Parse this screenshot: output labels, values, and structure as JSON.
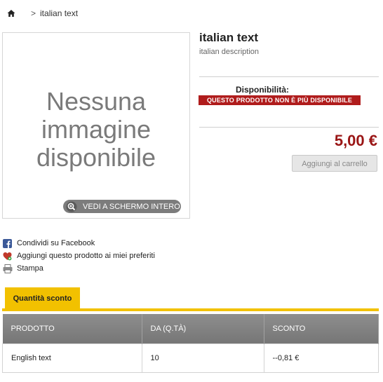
{
  "breadcrumb": {
    "home_icon": "home-icon",
    "separator": ">",
    "current": "italian text"
  },
  "image": {
    "placeholder_lines": [
      "Nessuna",
      "immagine",
      "disponibile"
    ],
    "fullscreen_label": "VEDI A SCHERMO INTERO",
    "fullscreen_icon": "zoom-icon"
  },
  "product": {
    "title": "italian text",
    "description": "italian description",
    "availability_label": "Disponibilità:",
    "availability_status": "QUESTO PRODOTTO NON È PIÙ DISPONIBILE",
    "price": "5,00 €",
    "add_to_cart_label": "Aggiungi al carrello"
  },
  "actions": [
    {
      "icon": "facebook-icon",
      "label": "Condividi su Facebook"
    },
    {
      "icon": "heart-icon",
      "label": "Aggiungi questo prodotto ai miei preferiti"
    },
    {
      "icon": "printer-icon",
      "label": "Stampa"
    }
  ],
  "discount": {
    "tab_label": "Quantità sconto",
    "headers": [
      "PRODOTTO",
      "DA (Q.TÀ)",
      "SCONTO"
    ],
    "rows": [
      [
        "English text",
        "10",
        "--0,81 €"
      ]
    ]
  },
  "colors": {
    "accent": "#f2c100",
    "price": "#9a1515",
    "badge": "#b01c1c"
  }
}
